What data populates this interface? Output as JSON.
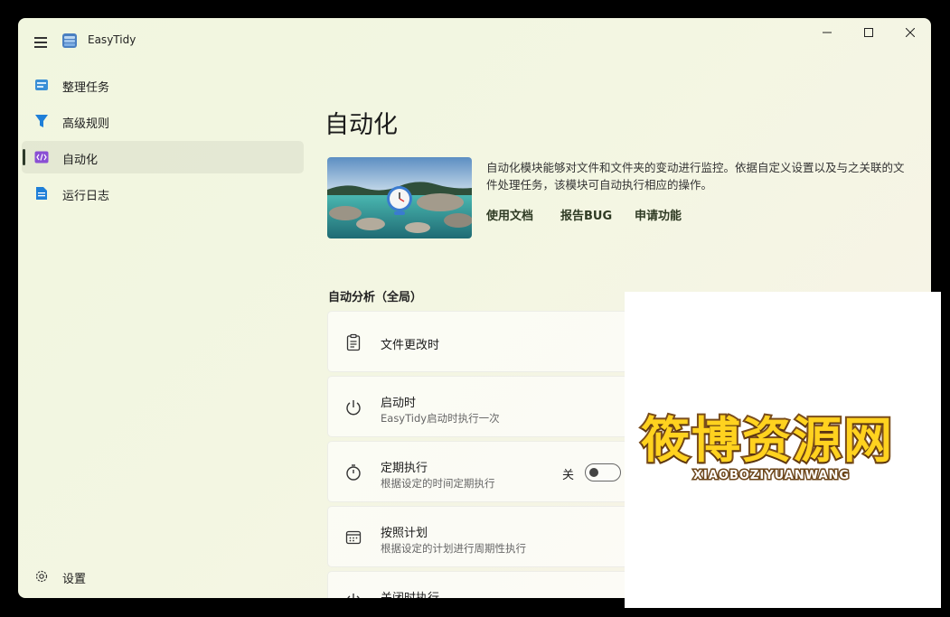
{
  "app": {
    "title": "EasyTidy"
  },
  "sidebar": {
    "items": [
      {
        "label": "整理任务",
        "icon": "task-icon"
      },
      {
        "label": "高级规则",
        "icon": "filter-icon"
      },
      {
        "label": "自动化",
        "icon": "code-icon",
        "selected": true
      },
      {
        "label": "运行日志",
        "icon": "log-icon"
      }
    ],
    "settings_label": "设置"
  },
  "main": {
    "page_title": "自动化",
    "description": "自动化模块能够对文件和文件夹的变动进行监控。依据自定义设置以及与之关联的文件处理任务，该模块可自动执行相应的操作。",
    "links": [
      "使用文档",
      "报告BUG",
      "申请功能"
    ],
    "section_title": "自动分析（全局）",
    "cards": [
      {
        "title": "文件更改时",
        "subtitle": "",
        "icon": "clipboard-icon"
      },
      {
        "title": "启动时",
        "subtitle": "EasyTidy启动时执行一次",
        "icon": "power-icon"
      },
      {
        "title": "定期执行",
        "subtitle": "根据设定的时间定期执行",
        "icon": "timer-icon",
        "toggle_label": "关",
        "toggle_on": false
      },
      {
        "title": "按照计划",
        "subtitle": "根据设定的计划进行周期性执行",
        "icon": "calendar-icon"
      },
      {
        "title": "关闭时执行",
        "subtitle": "",
        "icon": "power-icon"
      }
    ]
  },
  "watermark": {
    "cn": "筱博资源网",
    "en": "XIAOBOZIYUANWANG"
  },
  "colors": {
    "window_bg": "#f1f6df",
    "accent": "#2d3a2a"
  }
}
